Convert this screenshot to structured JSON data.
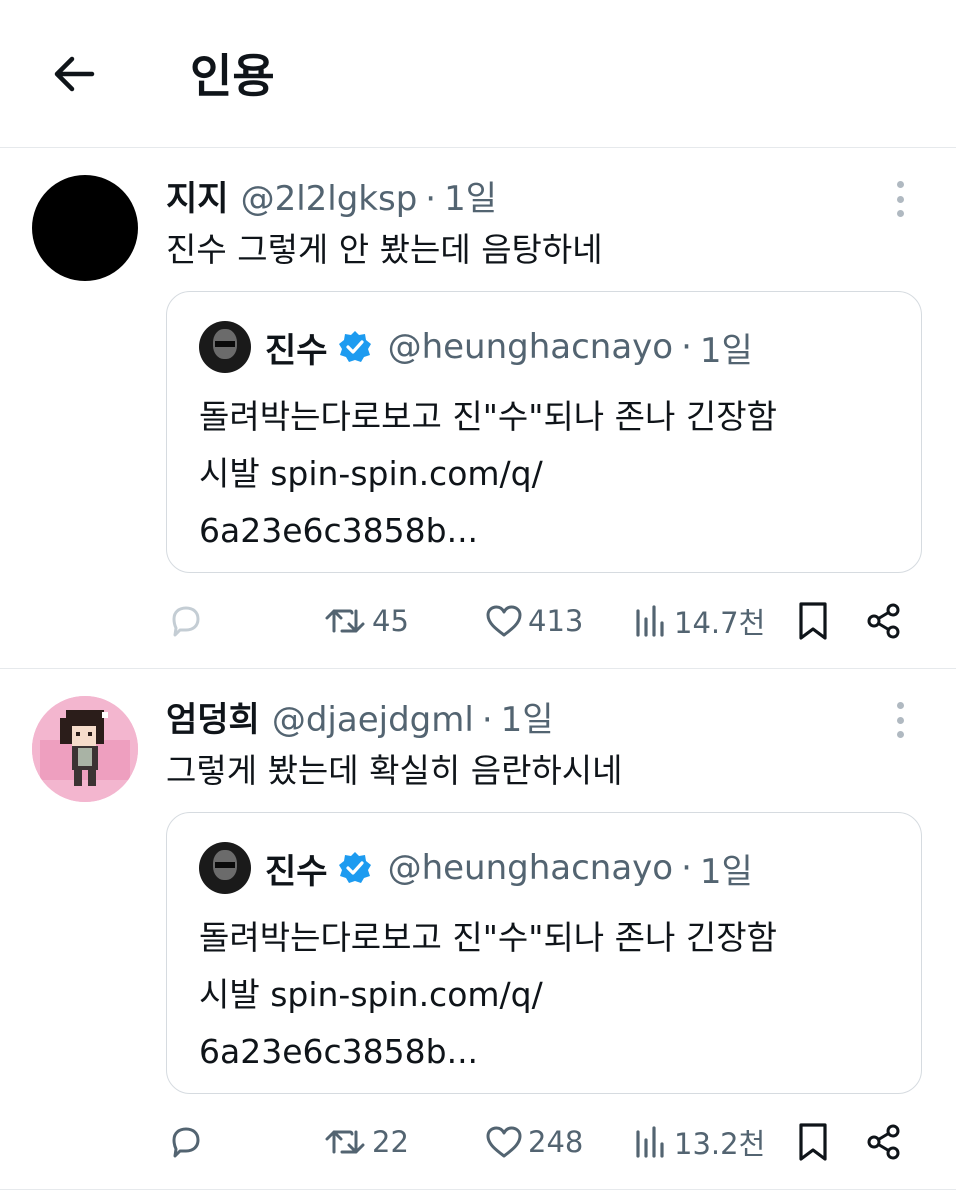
{
  "header": {
    "title": "인용"
  },
  "tweets": [
    {
      "name": "지지",
      "handle": "@2l2lgksp",
      "separator": "·",
      "time": "1일",
      "text": "진수 그렇게 안 봤는데 음탕하네",
      "quote": {
        "name": "진수",
        "handle": "@heunghacnayo",
        "separator": "·",
        "time": "1일",
        "lines": [
          "돌려박는다로보고 진\"수\"되나 존나 긴장함",
          "시발 spin-spin.com/q/",
          "6a23e6c3858b..."
        ]
      },
      "stats": {
        "retweets": "45",
        "likes": "413",
        "views": "14.7천"
      }
    },
    {
      "name": "엄덩희",
      "handle": "@djaejdgml",
      "separator": "·",
      "time": "1일",
      "text": "그렇게 봤는데 확실히 음란하시네",
      "quote": {
        "name": "진수",
        "handle": "@heunghacnayo",
        "separator": "·",
        "time": "1일",
        "lines": [
          "돌려박는다로보고 진\"수\"되나 존나 긴장함",
          "시발 spin-spin.com/q/",
          "6a23e6c3858b..."
        ]
      },
      "stats": {
        "retweets": "22",
        "likes": "248",
        "views": "13.2천"
      }
    }
  ],
  "colors": {
    "text": "#0f1419",
    "secondary": "#536471",
    "verified": "#1d9bf0",
    "divider": "#e6e9ec"
  },
  "icons": [
    "back-arrow-icon",
    "more-dots-icon",
    "verified-badge-icon",
    "reply-icon",
    "retweet-icon",
    "like-heart-icon",
    "views-chart-icon",
    "bookmark-icon",
    "share-icon"
  ]
}
